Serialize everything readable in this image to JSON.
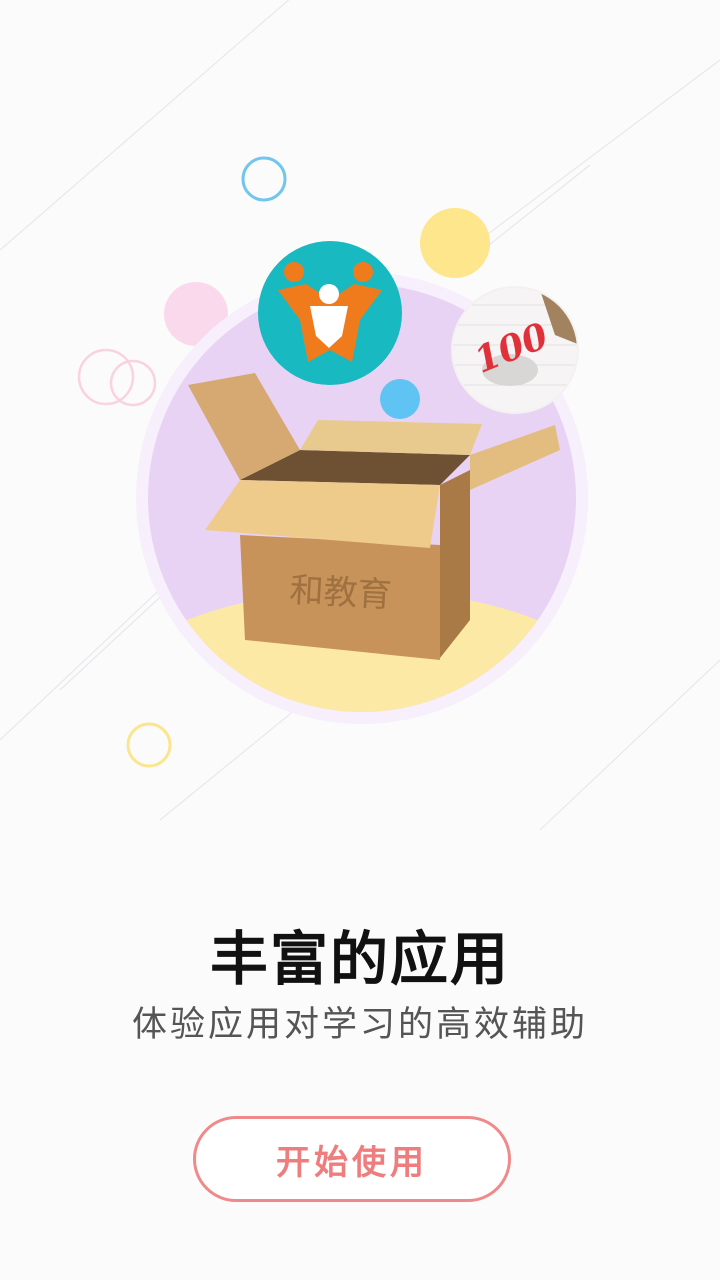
{
  "onboarding": {
    "box_label": "和教育",
    "badge_score": "100",
    "title": "丰富的应用",
    "subtitle": "体验应用对学习的高效辅助",
    "start_button_label": "开始使用"
  },
  "colors": {
    "accent": "#ef7d7d",
    "title_text": "#111111",
    "subtitle_text": "#555555",
    "circle_bg": "#e9d3f4",
    "ground": "#fde9a6",
    "box": "#c8935a",
    "app_icon_bg": "#18b9c0",
    "app_icon_fg": "#f07b1d"
  },
  "icons": [
    "app-logo-icon",
    "score-100-icon",
    "cardboard-box-icon"
  ]
}
